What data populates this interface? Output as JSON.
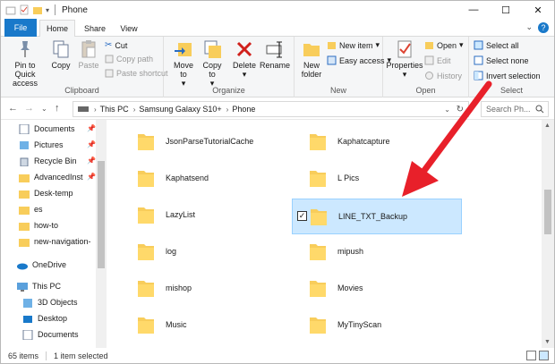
{
  "window": {
    "title": "Phone",
    "controls": {
      "minimize": "—",
      "maximize": "☐",
      "close": "✕"
    }
  },
  "ribbon_tabs": [
    "File",
    "Home",
    "Share",
    "View"
  ],
  "ribbon": {
    "clipboard": {
      "label": "Clipboard",
      "pin": "Pin to Quick access",
      "copy": "Copy",
      "paste": "Paste",
      "cut": "Cut",
      "copy_path": "Copy path",
      "paste_shortcut": "Paste shortcut"
    },
    "organize": {
      "label": "Organize",
      "move_to": "Move to",
      "copy_to": "Copy to",
      "delete": "Delete",
      "rename": "Rename"
    },
    "new": {
      "label": "New",
      "new_folder": "New folder",
      "new_item": "New item",
      "easy_access": "Easy access"
    },
    "open": {
      "label": "Open",
      "properties": "Properties",
      "open": "Open",
      "edit": "Edit",
      "history": "History"
    },
    "select": {
      "label": "Select",
      "select_all": "Select all",
      "select_none": "Select none",
      "invert_selection": "Invert selection"
    }
  },
  "address": {
    "crumbs": [
      "This PC",
      "Samsung Galaxy S10+",
      "Phone"
    ],
    "search_placeholder": "Search Ph..."
  },
  "nav_pane": {
    "quick_access": [
      {
        "label": "Documents",
        "pinned": true
      },
      {
        "label": "Pictures",
        "pinned": true
      },
      {
        "label": "Recycle Bin",
        "pinned": true
      },
      {
        "label": "AdvancedInst",
        "pinned": true
      },
      {
        "label": "Desk-temp",
        "pinned": false
      },
      {
        "label": "es",
        "pinned": false
      },
      {
        "label": "how-to",
        "pinned": false
      },
      {
        "label": "new-navigation-",
        "pinned": false
      }
    ],
    "onedrive": "OneDrive",
    "this_pc": "This PC",
    "this_pc_items": [
      "3D Objects",
      "Desktop",
      "Documents"
    ]
  },
  "folders": [
    {
      "name": "JsonParseTutorialCache",
      "selected": false
    },
    {
      "name": "Kaphatcapture",
      "selected": false
    },
    {
      "name": "Kaphatsend",
      "selected": false
    },
    {
      "name": "L Pics",
      "selected": false
    },
    {
      "name": "LazyList",
      "selected": false
    },
    {
      "name": "LINE_TXT_Backup",
      "selected": true
    },
    {
      "name": "log",
      "selected": false
    },
    {
      "name": "mipush",
      "selected": false
    },
    {
      "name": "mishop",
      "selected": false
    },
    {
      "name": "Movies",
      "selected": false
    },
    {
      "name": "Music",
      "selected": false
    },
    {
      "name": "MyTinyScan",
      "selected": false
    }
  ],
  "status": {
    "item_count": "65 items",
    "selected": "1 item selected"
  },
  "colors": {
    "accent": "#1979ca",
    "selection_bg": "#cce8ff",
    "folder": "#f8cd5b",
    "annotation_arrow": "#e8202a"
  }
}
